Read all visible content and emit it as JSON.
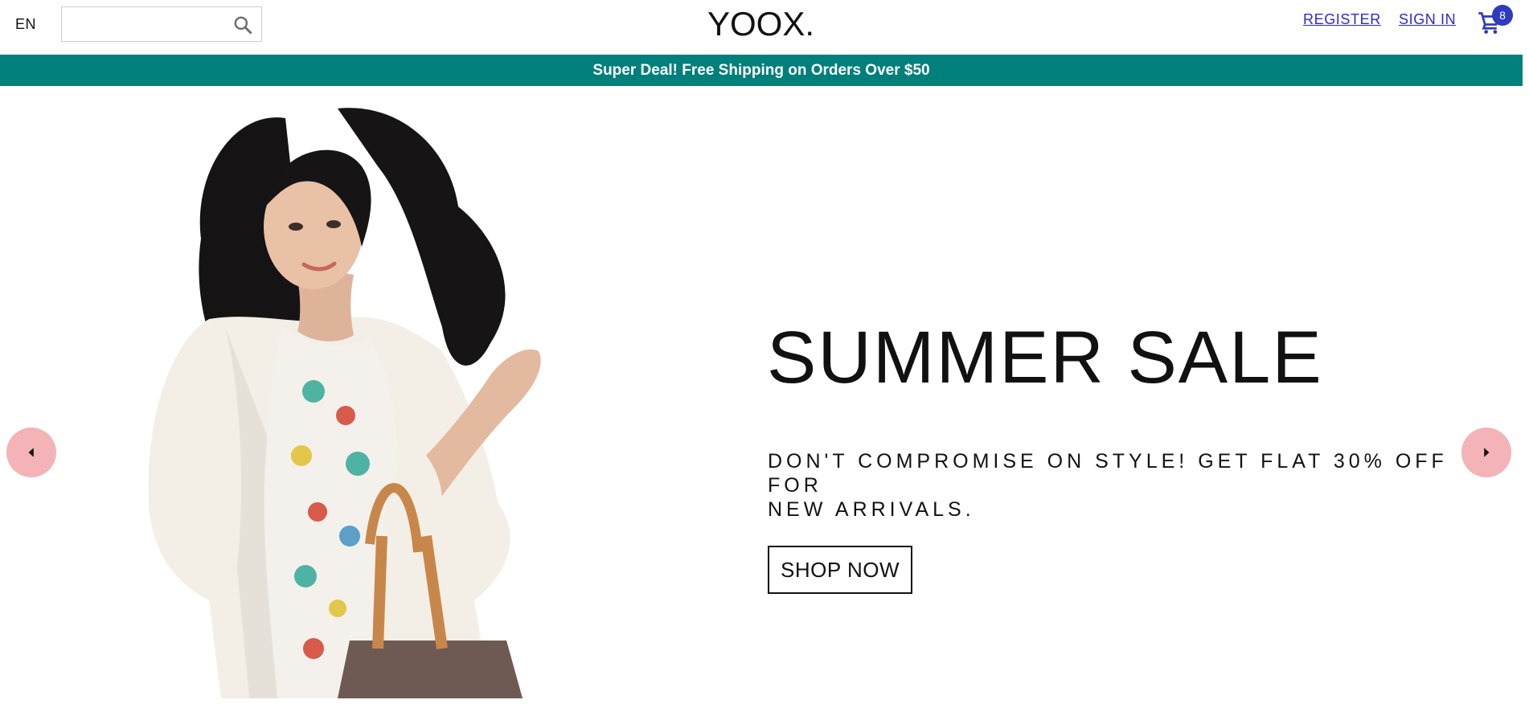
{
  "header": {
    "language": "EN",
    "search": {
      "value": "",
      "placeholder": ""
    },
    "logo": "YOOX.",
    "register_label": "REGISTER",
    "signin_label": "SIGN IN",
    "cart_count": "8"
  },
  "promo": {
    "text": "Super Deal! Free Shipping on Orders Over $50"
  },
  "hero": {
    "headline": "SUMMER SALE",
    "subtext": "DON'T COMPROMISE ON STYLE! GET FLAT 30% OFF FOR\nNEW ARRIVALS.",
    "cta_label": "SHOP NOW"
  },
  "icons": {
    "search": "search-icon",
    "cart": "cart-icon",
    "prev": "chevron-left-icon",
    "next": "chevron-right-icon"
  },
  "colors": {
    "promo_bg": "#007f7b",
    "link": "#2a2ad6",
    "badge": "#2d3bbd",
    "arrow_bg": "#f3b3b7"
  }
}
